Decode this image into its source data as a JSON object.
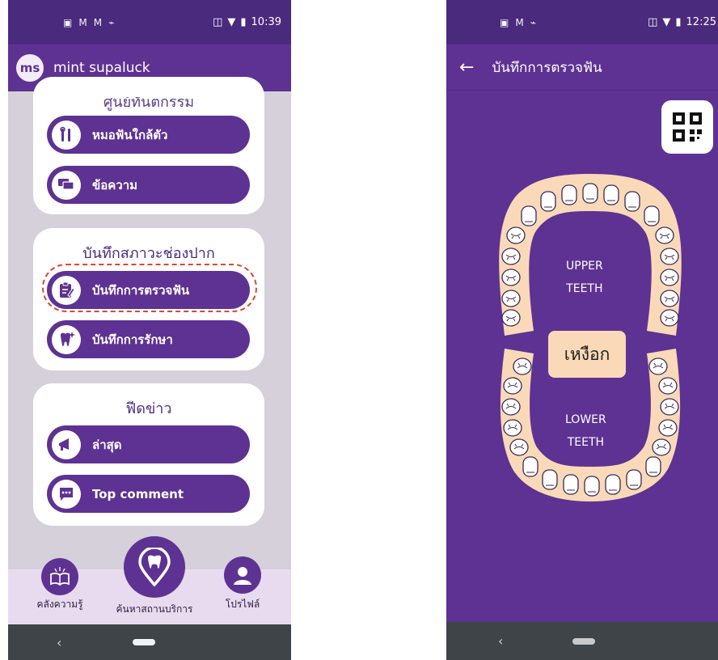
{
  "left_screen": {
    "status_bar": {
      "time": "10:39",
      "icons": [
        "sim-icon",
        "gmail-icon",
        "gmail-icon",
        "link-icon"
      ]
    },
    "app_bar": {
      "avatar_initials": "ms",
      "user_name": "mint supaluck"
    },
    "cards": {
      "top_partial_title": "ศูนย์ทันตกรรม",
      "dentist_near_me": "หมอฟันใกล้ตัว",
      "messages": "ข้อความ",
      "oral_record_title": "บันทึกสภาวะช่องปาก",
      "dental_exam_record": "บันทึกการตรวจฟัน",
      "treatment_record": "บันทึกการรักษา",
      "news_title": "ฟีดข่าว",
      "latest": "ล่าสุด",
      "top_comment": "Top comment"
    },
    "bottom_nav": {
      "knowledge": "คลังความรู้",
      "search_service": "ค้นหาสถานบริการ",
      "profile": "โปรไฟล์"
    },
    "highlight_color": "#e0462d"
  },
  "right_screen": {
    "status_bar": {
      "time": "12:25"
    },
    "app_bar": {
      "title": "บันทึกการตรวจฟัน"
    },
    "chart": {
      "upper_label_1": "UPPER",
      "upper_label_2": "TEETH",
      "lower_label_1": "LOWER",
      "lower_label_2": "TEETH",
      "gum_label": "เหงือก"
    },
    "colors": {
      "primary": "#5e3292",
      "dark": "#4a2a7d",
      "gum": "#f9d9b8",
      "tooth_outline": "#3a2a55"
    }
  }
}
